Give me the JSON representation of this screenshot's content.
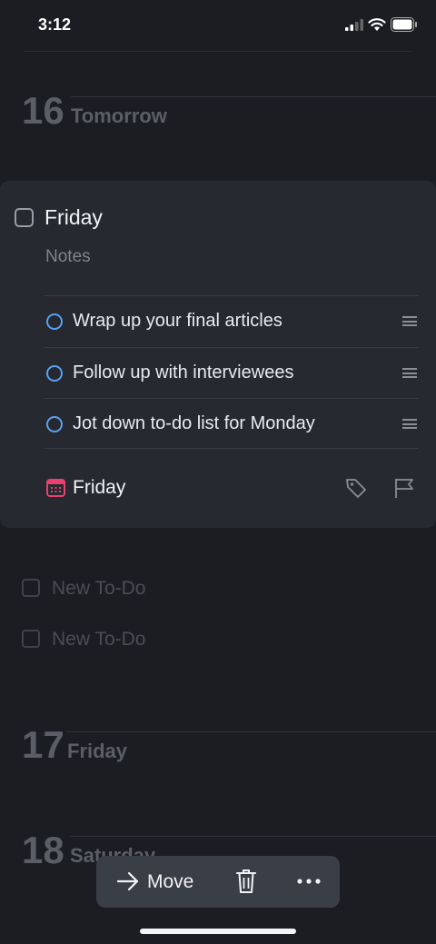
{
  "status_bar": {
    "time": "3:12"
  },
  "sections": [
    {
      "day_number": "16",
      "day_label": "Tomorrow"
    },
    {
      "day_number": "17",
      "day_label": "Friday"
    },
    {
      "day_number": "18",
      "day_label": "Saturday"
    }
  ],
  "card": {
    "title": "Friday",
    "notes_placeholder": "Notes",
    "checklist": [
      {
        "text": "Wrap up your final articles"
      },
      {
        "text": "Follow up with interviewees"
      },
      {
        "text": "Jot down to-do list for Monday"
      }
    ],
    "when_label": "Friday",
    "accent_color": "#e8416e",
    "checklist_color": "#5aa0f0"
  },
  "todos": [
    {
      "placeholder": "New To-Do"
    },
    {
      "placeholder": "New To-Do"
    }
  ],
  "action_bar": {
    "move_label": "Move"
  },
  "icons": [
    "calendar-icon",
    "tag-icon",
    "flag-icon",
    "arrow-right-icon",
    "trash-icon",
    "more-icon",
    "drag-handle-icon"
  ]
}
